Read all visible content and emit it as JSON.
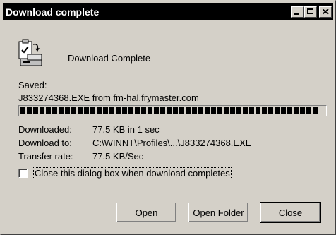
{
  "window": {
    "title": "Download complete",
    "controls": {
      "minimize": "_",
      "maximize": "□",
      "close": "×"
    }
  },
  "main": {
    "heading": "Download Complete",
    "saved_label": "Saved:",
    "saved_detail": "J833274368.EXE from fm-hal.frymaster.com",
    "progress_percent": 100,
    "rows": [
      {
        "label": "Downloaded:",
        "value": "77.5 KB in 1 sec"
      },
      {
        "label": "Download to:",
        "value": "C:\\WINNT\\Profiles\\...\\J833274368.EXE"
      },
      {
        "label": "Transfer rate:",
        "value": "77.5 KB/Sec"
      }
    ],
    "close_checkbox": {
      "label": "Close this dialog box when download completes",
      "checked": false
    }
  },
  "buttons": {
    "open": "Open",
    "open_folder": "Open Folder",
    "close": "Close"
  },
  "icons": {
    "dialog_icon": "download-document-icon"
  }
}
